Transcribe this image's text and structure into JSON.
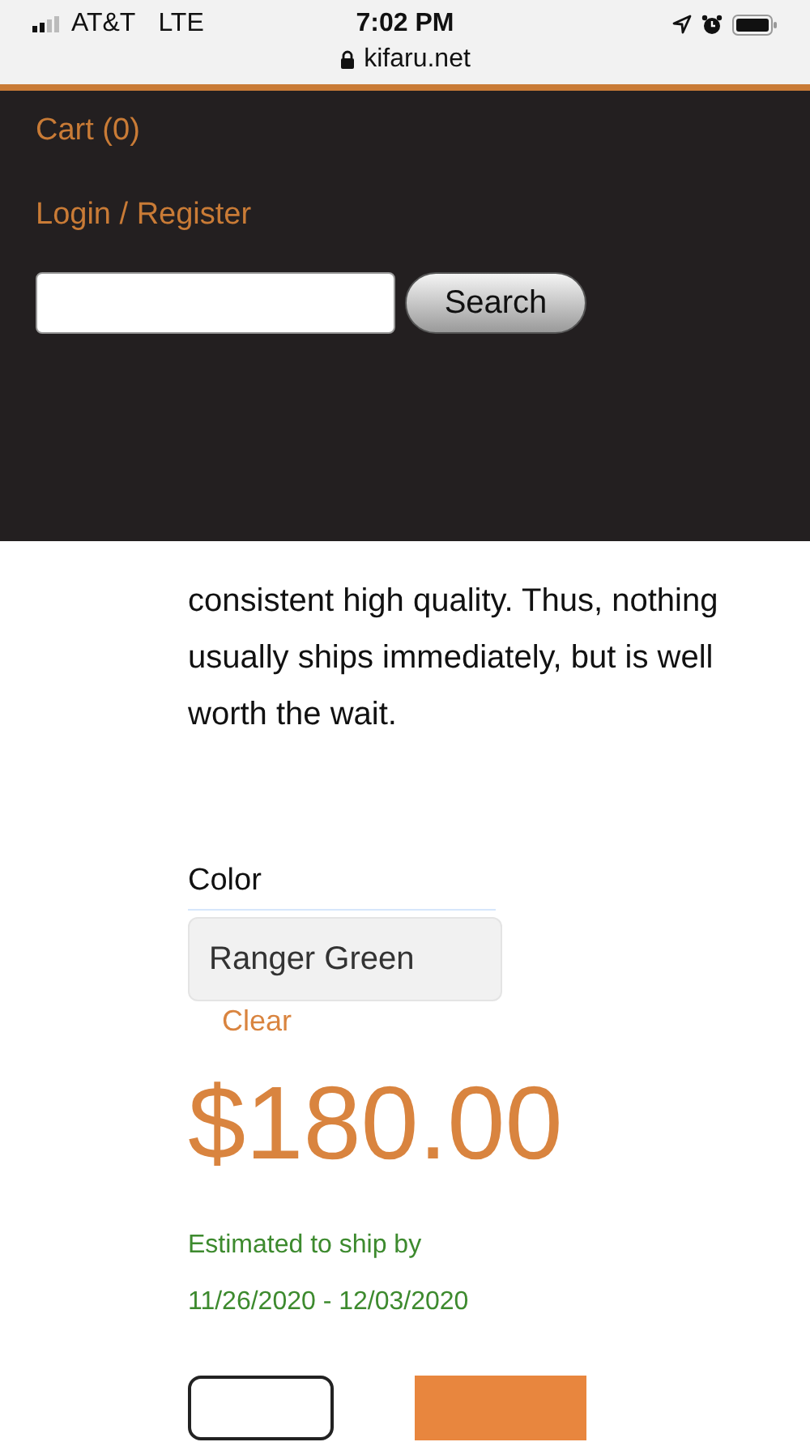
{
  "status_bar": {
    "carrier": "AT&T",
    "network": "LTE",
    "time": "7:02 PM",
    "url": "kifaru.net"
  },
  "menu": {
    "links": [
      "Cart (0)",
      "Login / Register"
    ],
    "search": {
      "button": "Search"
    }
  },
  "description": [
    "consistent high quality. Thus, nothing",
    "usually ships immediately, but is well",
    "worth the wait."
  ],
  "color_option": {
    "label": "Color",
    "value": "Ranger Green",
    "clear": "Clear"
  },
  "price": "$180.00",
  "shipping": [
    "Estimated to ship by",
    "11/26/2020 - 12/03/2020"
  ]
}
